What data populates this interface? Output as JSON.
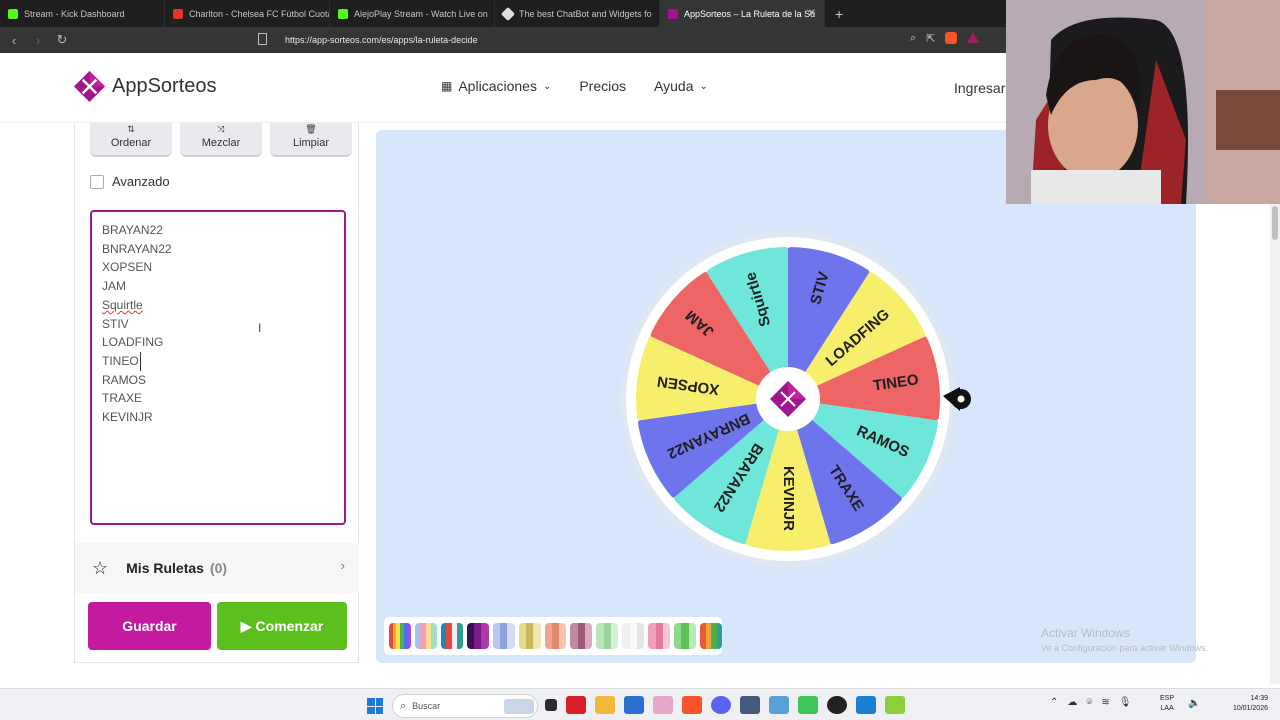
{
  "browser": {
    "tabs": [
      {
        "title": "Stream - Kick Dashboard",
        "color": "#53fc18"
      },
      {
        "title": "Charlton - Chelsea FC Fútbol Cuotas",
        "color": "#e0332a"
      },
      {
        "title": "AlejoPlay Stream - Watch Live on",
        "color": "#53fc18"
      },
      {
        "title": "The best ChatBot and Widgets fo",
        "color": "#dddddd"
      },
      {
        "title": "AppSorteos – La Ruleta de la Su",
        "color": "#a0168f"
      }
    ],
    "url": "https://app-sorteos.com/es/apps/la-ruleta-decide"
  },
  "header": {
    "logo": "AppSorteos",
    "nav": {
      "apps": "Aplicaciones",
      "prices": "Precios",
      "help": "Ayuda"
    },
    "login": "Ingresar"
  },
  "controls": {
    "sort": "Ordenar",
    "shuffle": "Mezclar",
    "clear": "Limpiar",
    "advanced": "Avanzado"
  },
  "entries": [
    "BRAYAN22",
    "BNRAYAN22",
    "XOPSEN",
    "JAM",
    "Squirtle",
    "STIV",
    "LOADFING",
    "TINEO",
    "RAMOS",
    "TRAXE",
    "KEVINJR"
  ],
  "my_wheels": {
    "label": "Mis Ruletas",
    "count": "(0)"
  },
  "actions": {
    "save": "Guardar",
    "start": "Comenzar"
  },
  "wheel": {
    "segments": [
      {
        "label": "STIV",
        "color": "#6e74ec"
      },
      {
        "label": "LOADFING",
        "color": "#f7ef6b"
      },
      {
        "label": "TINEO",
        "color": "#ee6565"
      },
      {
        "label": "RAMOS",
        "color": "#6ee6d9"
      },
      {
        "label": "TRAXE",
        "color": "#6e74ec"
      },
      {
        "label": "KEVINJR",
        "color": "#f7ef6b"
      },
      {
        "label": "BRAYAN22",
        "color": "#6ee6d9"
      },
      {
        "label": "BNRAYAN22",
        "color": "#6e74ec"
      },
      {
        "label": "XOPSEN",
        "color": "#f7ef6b"
      },
      {
        "label": "JAM",
        "color": "#ee6565"
      },
      {
        "label": "Squirtle",
        "color": "#6ee6d9"
      }
    ]
  },
  "windows": {
    "activate_title": "Activar Windows",
    "activate_sub": "Ve a Configuración para activar Windows."
  },
  "taskbar": {
    "search": "Buscar",
    "lang1": "ESP",
    "lang2": "LAA",
    "time": "14:39",
    "date": "10/01/2026"
  }
}
